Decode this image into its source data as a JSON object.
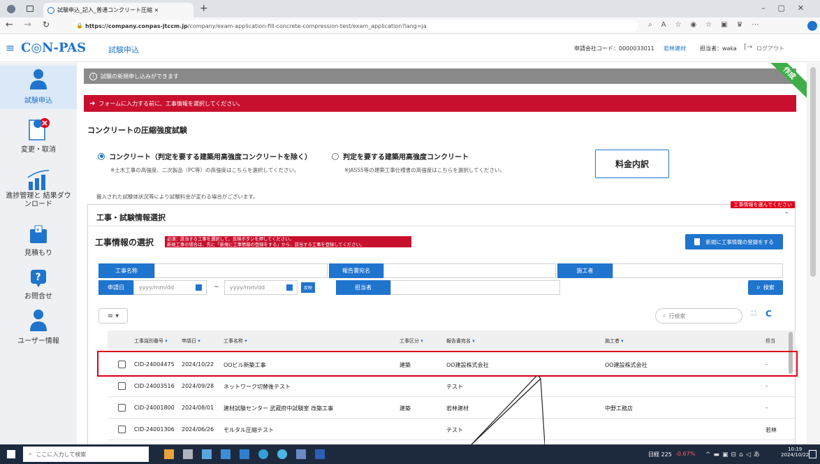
{
  "browser": {
    "tab_title": "試験申込_記入_普通コンクリート圧縮 ×",
    "url_host": "https://company.conpas-jtccm.jp",
    "url_path": "/company/exam-application-fill-concrete-compression-test/exam_application?lang=ja"
  },
  "header": {
    "logo": "C◎N-PAS",
    "page_title": "試験申込",
    "company_code_label": "申請会社コード：0000033011",
    "company_name": "若林建材",
    "user_label": "担当者：waka",
    "logout": "ログアウト"
  },
  "sidebar": {
    "items": [
      {
        "label": "試験申込",
        "icon": "person-icon"
      },
      {
        "label": "変更・取消",
        "icon": "cancel-doc-icon"
      },
      {
        "label": "進捗管理と 結果ダウンロード",
        "icon": "chart-icon"
      },
      {
        "label": "見積もり",
        "icon": "estimate-icon"
      },
      {
        "label": "お問合せ",
        "icon": "question-icon"
      },
      {
        "label": "ユーザー情報",
        "icon": "user-icon"
      }
    ]
  },
  "main": {
    "info_bar": "試験の新規申し込みができます",
    "ribbon": "作成",
    "warning_bar": "フォームに入力する前に、工事情報を選択してください。",
    "section_title": "コンクリートの圧縮強度試験",
    "radio1_label": "コンクリート（判定を要する建築用高強度コンクリートを除く）",
    "radio1_note": "※土木工事の高強度、二次製品（PC等）の高強度はこちらを選択してください。",
    "radio2_label": "判定を要する建築用高強度コンクリート",
    "radio2_note": "※JASS5等の建築工事仕様書の高強度はこちらを選択してください。",
    "fee_button": "料金内訳",
    "fee_notice": "搬入された試験体状況等により試験料金が変わる場合がございます。",
    "panel_badge": "工事情報を選んでください",
    "panel_title": "工事・試験情報選択",
    "select_title": "工事情報の選択",
    "select_warning_line1": "必須：該当する工事を選択して、反映ボタンを押してください。",
    "select_warning_line2": "新規工事の場合は、先に「新規に工事情報の登録をする」から、該当する工事を登録してください。",
    "new_button": "新規に工事情報の登録をする",
    "filters": {
      "project_name": "工事名称",
      "report_name": "報告書宛名",
      "contractor": "施工者",
      "apply_date": "申請日",
      "date_placeholder": "yyyy/mm/dd",
      "tilde": "~",
      "apply_button": "反映",
      "person": "担当者",
      "search": "検索"
    },
    "row_search_placeholder": "行検索",
    "columns": [
      "工事識別番号",
      "申請日",
      "工事名称",
      "工事区分",
      "報告書宛名",
      "施工者",
      "担当"
    ],
    "rows": [
      {
        "id": "CID-24004475",
        "date": "2024/10/22",
        "name": "OOビル新築工事",
        "kind": "建築",
        "report": "OO建設株式会社",
        "contractor": "OO建設株式会社",
        "person": "-"
      },
      {
        "id": "CID-24003516",
        "date": "2024/09/28",
        "name": "ネットワーク切替後テスト",
        "kind": "",
        "report": "テスト",
        "contractor": "",
        "person": "-"
      },
      {
        "id": "CID-24001800",
        "date": "2024/08/01",
        "name": "建材試験センター 武蔵府中試験室 改築工事",
        "kind": "建築",
        "report": "若林建材",
        "contractor": "中野工務店",
        "person": "-"
      },
      {
        "id": "CID-24001306",
        "date": "2024/06/26",
        "name": "モルタル圧縮テスト",
        "kind": "",
        "report": "テスト",
        "contractor": "",
        "person": "若林"
      }
    ]
  },
  "taskbar": {
    "search_placeholder": "ここに入力して検索",
    "stock_label": "日経 225",
    "stock_change": "-0.67%",
    "time": "10:19",
    "date": "2024/10/22"
  },
  "colors": {
    "primary": "#1f74ce",
    "warning": "#c8102e",
    "info_bar": "#8a8a8a",
    "ribbon": "#3fae49",
    "highlight": "#e0001a"
  }
}
